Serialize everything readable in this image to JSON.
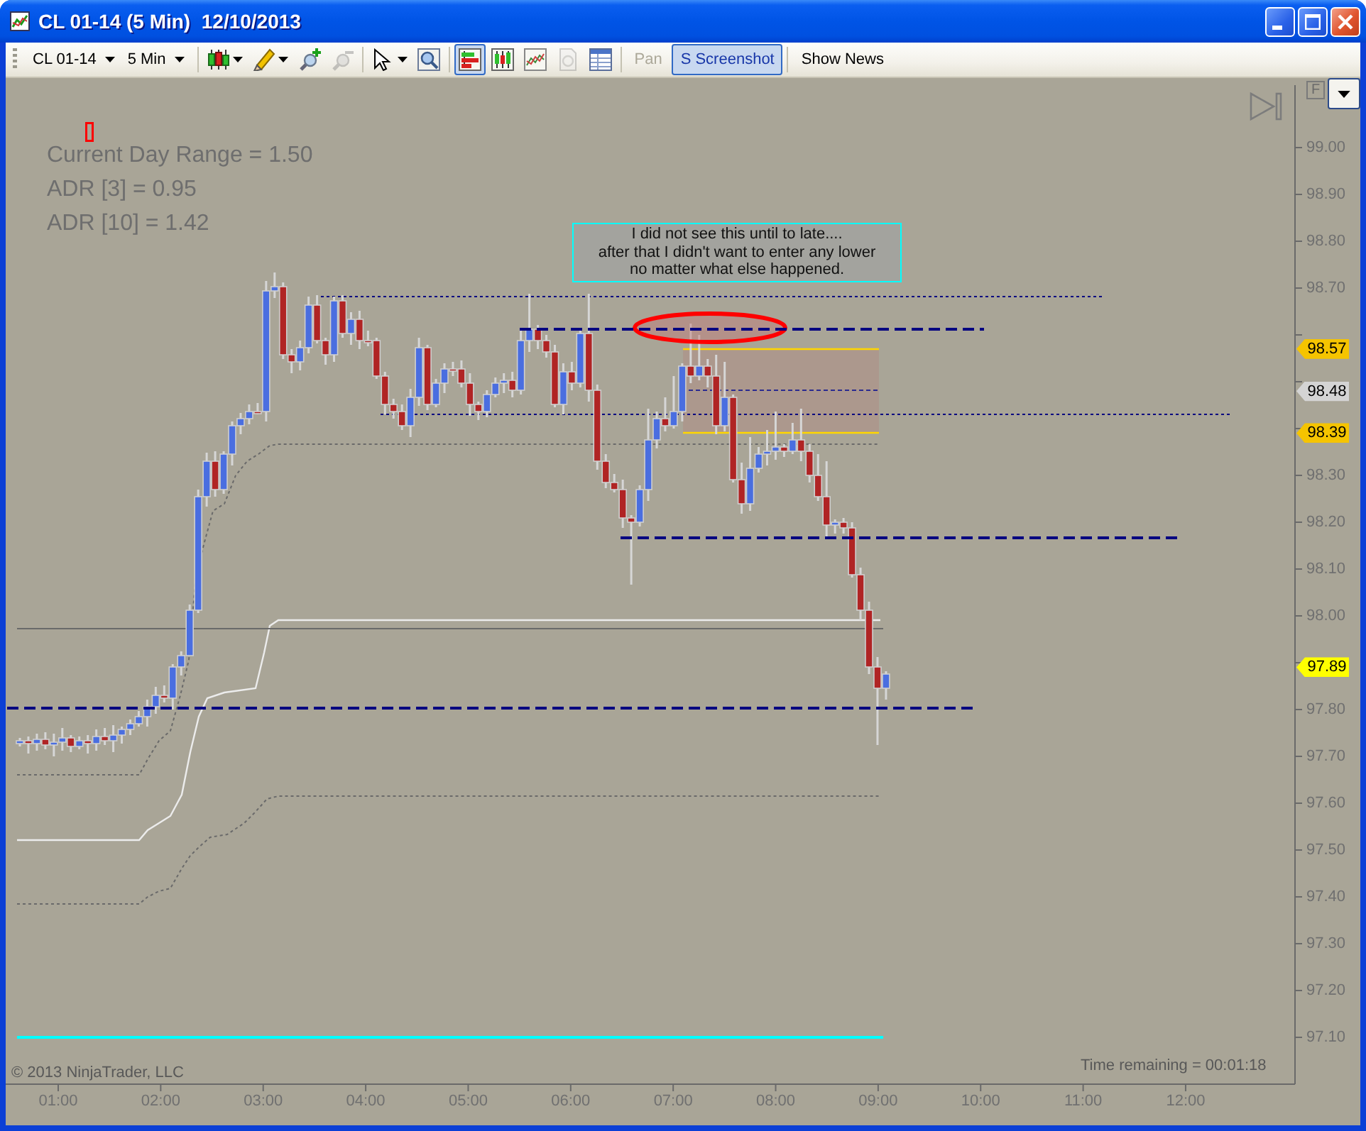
{
  "window": {
    "title": "CL 01-14 (5 Min)  12/10/2013"
  },
  "toolbar": {
    "groups": [
      {
        "items": [
          {
            "kind": "dropdown",
            "label": "CL 01-14"
          },
          {
            "kind": "dropdown",
            "label": "5 Min"
          }
        ]
      },
      {
        "items": [
          {
            "kind": "tool",
            "menu": true,
            "on": false,
            "disabled": false
          },
          {
            "kind": "tool",
            "menu": true,
            "on": false,
            "disabled": false
          },
          {
            "kind": "tool",
            "menu": false,
            "on": false,
            "disabled": false
          },
          {
            "kind": "tool",
            "menu": false,
            "on": false,
            "disabled": true
          }
        ]
      },
      {
        "items": [
          {
            "kind": "tool",
            "menu": true,
            "on": false,
            "disabled": false
          },
          {
            "kind": "tool",
            "menu": false,
            "on": false,
            "disabled": false
          }
        ]
      },
      {
        "items": [
          {
            "kind": "tool",
            "menu": false,
            "on": true,
            "disabled": false
          },
          {
            "kind": "tool",
            "menu": false,
            "on": false,
            "disabled": false
          },
          {
            "kind": "tool",
            "menu": false,
            "on": false,
            "disabled": false
          },
          {
            "kind": "tool",
            "menu": false,
            "on": false,
            "disabled": true
          },
          {
            "kind": "tool",
            "menu": false,
            "on": false,
            "disabled": false
          }
        ]
      },
      {
        "items": [
          {
            "kind": "button",
            "label": "Pan",
            "on": false,
            "disabled": true
          },
          {
            "kind": "button",
            "label": "S Screenshot",
            "on": true,
            "disabled": false
          }
        ]
      },
      {
        "items": [
          {
            "kind": "button",
            "label": "Show News",
            "on": false,
            "disabled": false
          }
        ]
      }
    ]
  },
  "chart": {
    "indicators": [
      "Current Day Range = 1.50",
      "ADR [3] = 0.95",
      "ADR [10] = 1.42"
    ],
    "note": {
      "lines": [
        "I did not see this until to late....",
        "after that I didn't want to enter any lower",
        "no matter what else happened."
      ]
    },
    "scale_toggle": {
      "label": "F"
    },
    "price_tags": [
      {
        "label": "98.57",
        "color": "#f5c400"
      },
      {
        "label": "98.48",
        "color": "#d4d4d4"
      },
      {
        "label": "98.39",
        "color": "#f5c400"
      },
      {
        "label": "97.89",
        "color": "#ffff00"
      }
    ],
    "price_axis": {
      "labels": [
        "99.00",
        "98.90",
        "98.80",
        "98.70",
        "98.30",
        "98.20",
        "98.10",
        "98.00",
        "97.80",
        "97.70",
        "97.60",
        "97.50",
        "97.40",
        "97.30",
        "97.20",
        "97.10"
      ]
    },
    "time_axis": {
      "labels": [
        "01:00",
        "02:00",
        "03:00",
        "04:00",
        "05:00",
        "06:00",
        "07:00",
        "08:00",
        "09:00",
        "10:00",
        "11:00",
        "12:00"
      ]
    },
    "copyright": "© 2013 NinjaTrader, LLC",
    "time_remaining": "Time remaining = 00:01:18"
  }
}
